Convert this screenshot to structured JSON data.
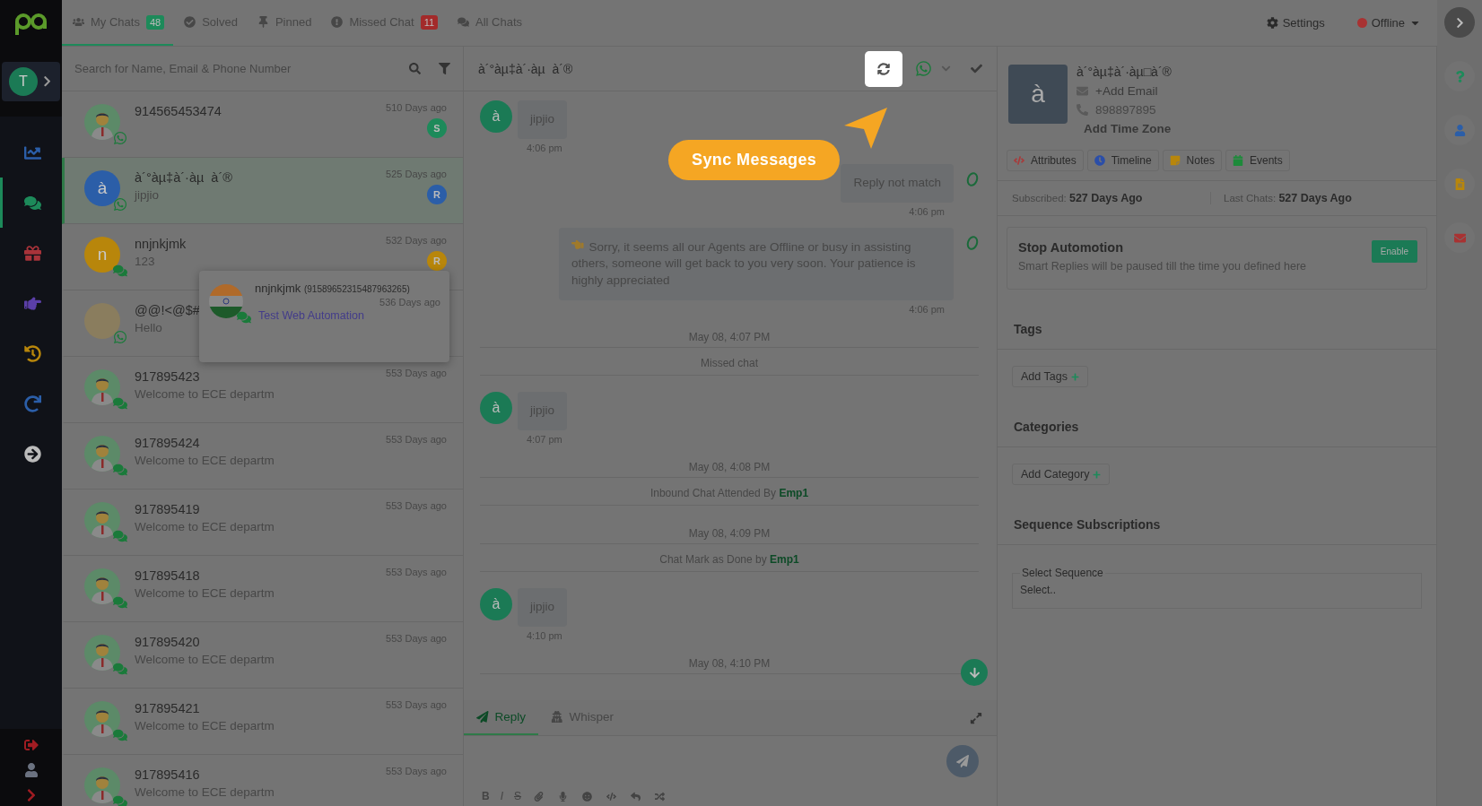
{
  "nav": {
    "user_initial": "T"
  },
  "nav_items": [
    {
      "kind": "chart",
      "color": "#2b5ea8",
      "selected": false
    },
    {
      "kind": "chat",
      "color": "#1d8a5a",
      "selected": true
    },
    {
      "kind": "gift",
      "color": "#a8333a",
      "selected": false
    },
    {
      "kind": "hand",
      "color": "#5b3fa8",
      "selected": false
    },
    {
      "kind": "history",
      "color": "#b8860b",
      "selected": false
    },
    {
      "kind": "redo",
      "color": "#2b5ea8",
      "selected": false
    },
    {
      "kind": "arrow",
      "color": "#bbbbbb",
      "selected": false
    }
  ],
  "nav_bottom": [
    {
      "kind": "logout",
      "color": "#a01c22"
    },
    {
      "kind": "user",
      "color": "#6b7280"
    },
    {
      "kind": "chevron",
      "color": "#a01c22"
    }
  ],
  "tabs": [
    {
      "kind": "users",
      "label": "My Chats",
      "count": "48",
      "color": "#1d8a5a",
      "selected": true
    },
    {
      "kind": "check",
      "label": "Solved",
      "selected": false
    },
    {
      "kind": "pin",
      "label": "Pinned",
      "selected": false
    },
    {
      "kind": "alert",
      "label": "Missed Chat",
      "count": "11",
      "color": "#a32a2a",
      "selected": false
    },
    {
      "kind": "chats",
      "label": "All Chats",
      "selected": false
    }
  ],
  "settings": "Settings",
  "status": {
    "label": "Offline",
    "color": "#a83232"
  },
  "search": {
    "placeholder": "Search for Name, Email & Phone Number"
  },
  "chats": [
    {
      "kind": "person",
      "name": "914565453474",
      "time": "510 Days ago",
      "agent": "S",
      "color": "#1d8a5a",
      "whatsapp": true,
      "selected": false
    },
    {
      "kind": "letter",
      "name": "à´°àµ‡à´·àµ  à´®",
      "message": "jipjio",
      "time": "525 Days ago",
      "agent": "R",
      "color": "#2b5ea8",
      "initial": "à",
      "whatsapp": true,
      "selected": true
    },
    {
      "kind": "letter",
      "name": "nnjnkjmk",
      "message": "123",
      "time": "532 Days ago",
      "agent": "R",
      "color": "#b8860b",
      "initial": "n",
      "whatsapp": false,
      "selected": false
    },
    {
      "kind": "photo",
      "name": "@@!<@$#",
      "message": "Hello",
      "whatsapp": true,
      "selected": false
    },
    {
      "kind": "person",
      "name": "917895423",
      "message": "Welcome to ECE departm",
      "time": "553 Days ago",
      "whatsapp": false,
      "selected": false
    },
    {
      "kind": "person",
      "name": "917895424",
      "message": "Welcome to ECE departm",
      "time": "553 Days ago",
      "whatsapp": false,
      "selected": false
    },
    {
      "kind": "person",
      "name": "917895419",
      "message": "Welcome to ECE departm",
      "time": "553 Days ago",
      "whatsapp": false,
      "selected": false
    },
    {
      "kind": "person",
      "name": "917895418",
      "message": "Welcome to ECE departm",
      "time": "553 Days ago",
      "whatsapp": false,
      "selected": false
    },
    {
      "kind": "person",
      "name": "917895420",
      "message": "Welcome to ECE departm",
      "time": "553 Days ago",
      "whatsapp": false,
      "selected": false
    },
    {
      "kind": "person",
      "name": "917895421",
      "message": "Welcome to ECE departm",
      "time": "553 Days ago",
      "whatsapp": false,
      "selected": false
    },
    {
      "kind": "person",
      "name": "917895416",
      "message": "Welcome to ECE departm",
      "time": "553 Days ago",
      "whatsapp": false,
      "selected": false
    }
  ],
  "popup": {
    "name": "nnjnkjmk",
    "phone": "(91589652315487963265)",
    "time": "536 Days ago",
    "message": "Test Web Automation"
  },
  "conversation": {
    "title": "à´°àµ‡à´·àµ  à´®",
    "callout": "Sync Messages",
    "messages": [
      {
        "kind": "in",
        "initial": "à",
        "text": "jipjio",
        "time": "4:06 pm"
      },
      {
        "kind": "out",
        "pointer": false,
        "text": "Reply not match",
        "time": "4:06 pm"
      },
      {
        "kind": "out",
        "pointer": true,
        "text": "Sorry, it seems all our Agents are Offline or busy in assisting others, someone will get back to you very soon. Your patience is highly appreciated",
        "time": "4:06 pm"
      },
      {
        "kind": "date",
        "text": "May 08, 4:07 PM"
      },
      {
        "kind": "event",
        "text": "Missed chat"
      },
      {
        "kind": "in",
        "initial": "à",
        "text": "jipjio",
        "time": "4:07 pm"
      },
      {
        "kind": "date",
        "text": "May 08, 4:08 PM"
      },
      {
        "kind": "event",
        "text": "Inbound Chat Attended By",
        "agent": "Emp1"
      },
      {
        "kind": "date",
        "text": "May 08, 4:09 PM"
      },
      {
        "kind": "event",
        "text": "Chat Mark as Done by",
        "agent": "Emp1"
      },
      {
        "kind": "in",
        "initial": "à",
        "text": "jipjio",
        "time": "4:10 pm"
      },
      {
        "kind": "date",
        "text": "May 08, 4:10 PM"
      }
    ],
    "composer_tabs": [
      {
        "kind": "reply",
        "label": "Reply",
        "selected": true
      },
      {
        "kind": "whisper",
        "label": "Whisper",
        "selected": false
      }
    ],
    "format_buttons": [
      "B",
      "I",
      "S"
    ]
  },
  "profile": {
    "initial": "à",
    "name": "à´°àµ‡à´·àµ□à´®",
    "email": "+Add Email",
    "phone": "898897895",
    "timezone": "Add Time Zone"
  },
  "profile_tabs": [
    {
      "kind": "code",
      "label": "Attributes",
      "color": "#a83a3a"
    },
    {
      "kind": "clock",
      "label": "Timeline",
      "color": "#2b4ea8"
    },
    {
      "kind": "note",
      "label": "Notes",
      "color": "#b8860b"
    },
    {
      "kind": "calendar",
      "label": "Events",
      "color": "#1d8a3a"
    }
  ],
  "stats": [
    {
      "label": "Subscribed:",
      "value": "527 Days Ago"
    },
    {
      "label": "Last Chats:",
      "value": "527 Days Ago"
    }
  ],
  "automation": {
    "title": "Stop Automotion",
    "text": "Smart Replies will be paused till the time you defined here",
    "button": "Enable"
  },
  "sections": [
    {
      "kind": "button",
      "title": "Tags",
      "button": "Add Tags"
    },
    {
      "kind": "button",
      "title": "Categories",
      "button": "Add Category"
    },
    {
      "kind": "select",
      "title": "Sequence Subscriptions",
      "field_label": "Select Sequence",
      "placeholder": "Select.."
    }
  ],
  "rail": [
    {
      "kind": "expand"
    },
    {
      "kind": "help",
      "color": "#1d8a5a"
    },
    {
      "kind": "user",
      "color": "#2b5ea8"
    },
    {
      "kind": "file",
      "color": "#b8860b"
    },
    {
      "kind": "mail",
      "color": "#a83232"
    }
  ]
}
